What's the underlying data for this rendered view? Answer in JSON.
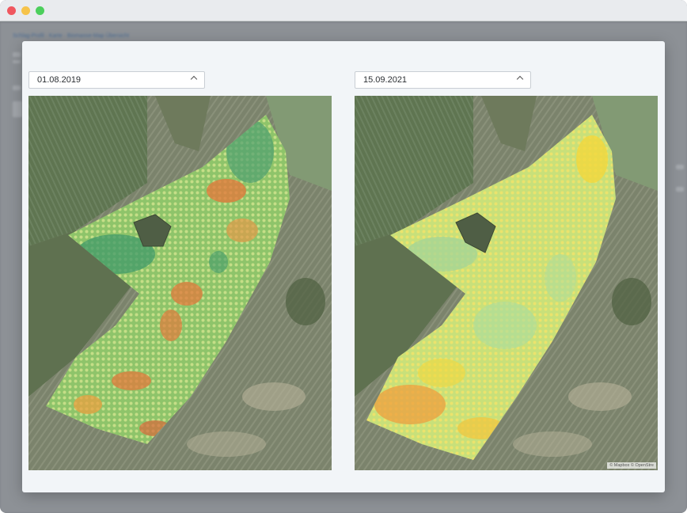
{
  "window": {
    "controls": [
      "close",
      "minimize",
      "maximize"
    ],
    "colors": {
      "close": "#f0575f",
      "minimize": "#f6c34a",
      "maximize": "#4ccf5c"
    }
  },
  "background": {
    "breadcrumb": "Schlag-Profil · Karte · Biomasse-Map Übersicht"
  },
  "comparison": {
    "left": {
      "date": "01.08.2019",
      "icon": "chevron-up-icon"
    },
    "right": {
      "date": "15.09.2021",
      "icon": "chevron-up-icon"
    },
    "attribution": "© Mapbox © OpenStre"
  },
  "colors": {
    "low": "#3f9a6a",
    "mid": "#a8d46a",
    "high_left": "#e07a3c",
    "high_right": "#f2d73c",
    "modal_bg": "#f2f5f8"
  }
}
